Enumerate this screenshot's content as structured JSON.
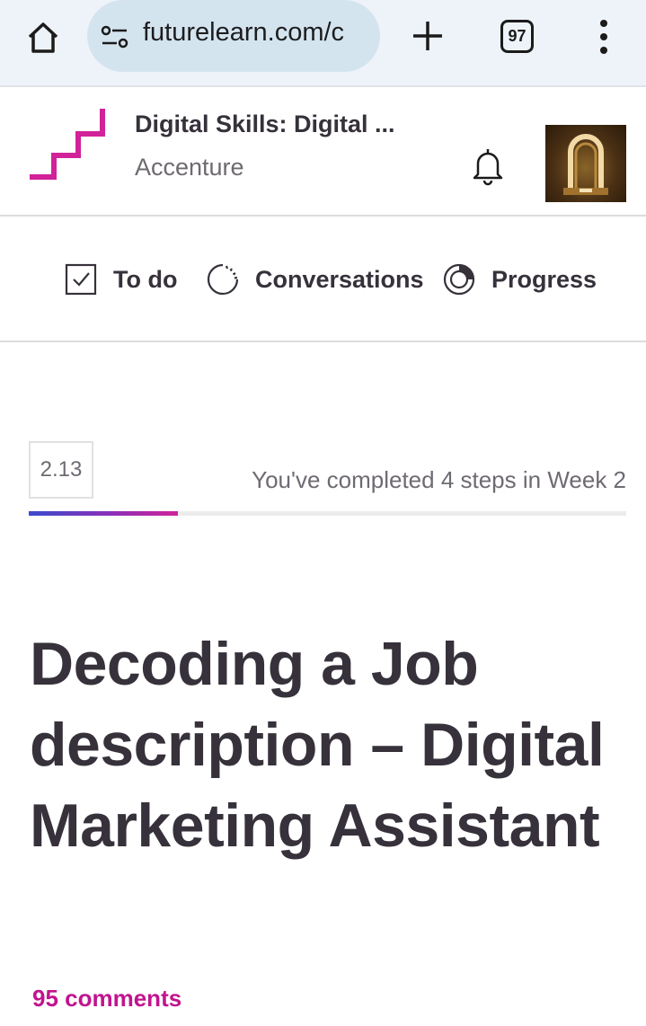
{
  "browser": {
    "url": "futurelearn.com/c",
    "tab_count": "97"
  },
  "course": {
    "title": "Digital Skills: Digital ...",
    "provider": "Accenture"
  },
  "nav": {
    "items": [
      {
        "label": "To do",
        "icon": "checkbox-icon"
      },
      {
        "label": "Conversations",
        "icon": "conversation-icon"
      },
      {
        "label": "Progress",
        "icon": "progress-icon"
      }
    ]
  },
  "step": {
    "number": "2.13",
    "status": "You've completed 4 steps in Week 2",
    "progress_fraction": 0.25
  },
  "page": {
    "title": "Decoding a Job description – Digital Marketing Assistant",
    "comments": "95 comments"
  },
  "colors": {
    "brand_magenta": "#d1229a",
    "progress_start": "#3b4bcd",
    "text_dark": "#36313a",
    "text_muted": "#6f6a72"
  }
}
